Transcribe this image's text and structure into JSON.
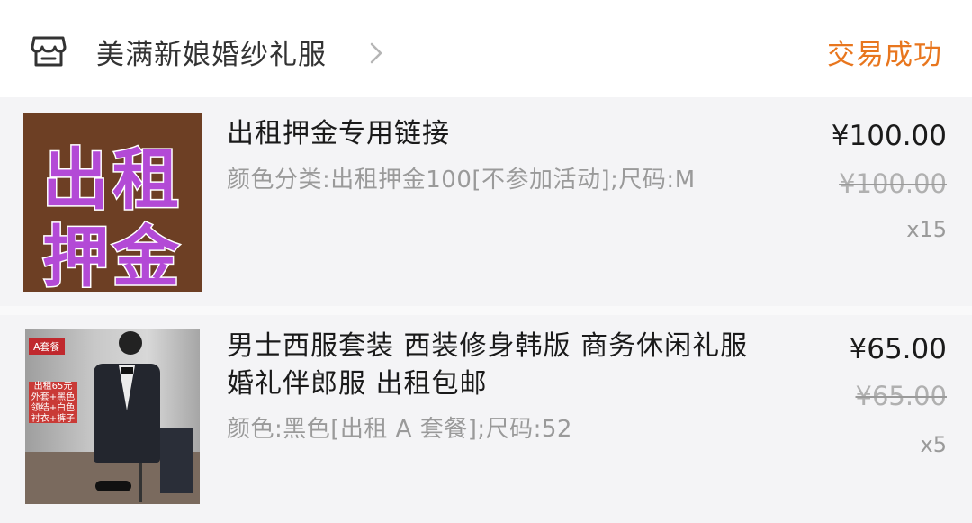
{
  "header": {
    "shop_icon": "store-icon",
    "shop_name": "美满新娘婚纱礼服",
    "chevron_icon": "chevron-right-icon",
    "status": "交易成功",
    "status_color": "#e8761e"
  },
  "items": [
    {
      "thumbnail": {
        "line1": "出租",
        "line2": "押金"
      },
      "title": "出租押金专用链接",
      "spec": "颜色分类:出租押金100[不参加活动];尺码:M",
      "price": "¥100.00",
      "original_price": "¥100.00",
      "quantity": "x15"
    },
    {
      "thumbnail": {
        "badge": "A套餐",
        "price_tag": "出租65元",
        "price_tag_detail": "外套+黑色领结+白色衬衣+裤子"
      },
      "title": "男士西服套装 西装修身韩版  商务休闲礼服  婚礼伴郎服 出租包邮",
      "spec": "颜色:黑色[出租 A 套餐];尺码:52",
      "price": "¥65.00",
      "original_price": "¥65.00",
      "quantity": "x5"
    }
  ]
}
